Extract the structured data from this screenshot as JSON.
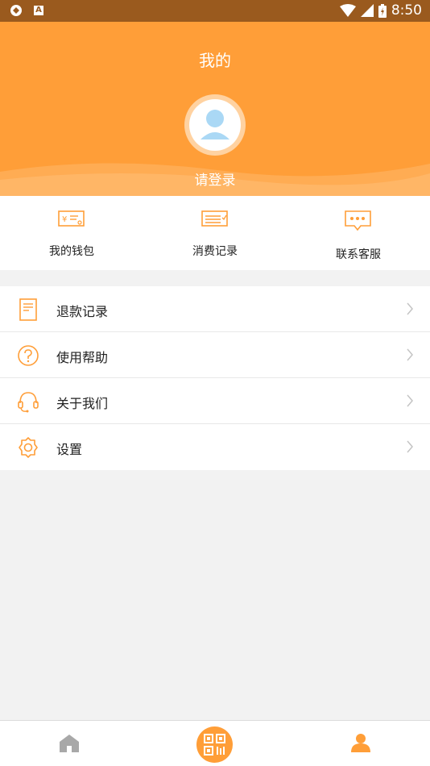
{
  "status": {
    "time": "8:50"
  },
  "header": {
    "title": "我的",
    "login_prompt": "请登录"
  },
  "quick_actions": [
    {
      "label": "我的钱包",
      "icon": "wallet-icon"
    },
    {
      "label": "消费记录",
      "icon": "receipt-icon"
    },
    {
      "label": "联系客服",
      "icon": "chat-icon"
    }
  ],
  "menu": [
    {
      "label": "退款记录",
      "icon": "document-icon"
    },
    {
      "label": "使用帮助",
      "icon": "question-icon"
    },
    {
      "label": "关于我们",
      "icon": "headset-icon"
    },
    {
      "label": "设置",
      "icon": "gear-icon"
    }
  ],
  "tabbar": [
    {
      "icon": "home-icon",
      "active": false
    },
    {
      "icon": "scan-icon",
      "active": false
    },
    {
      "icon": "user-icon",
      "active": true
    }
  ],
  "colors": {
    "accent": "#ff9e38",
    "statusbar": "#9a5a1e",
    "background": "#f2f2f2"
  }
}
